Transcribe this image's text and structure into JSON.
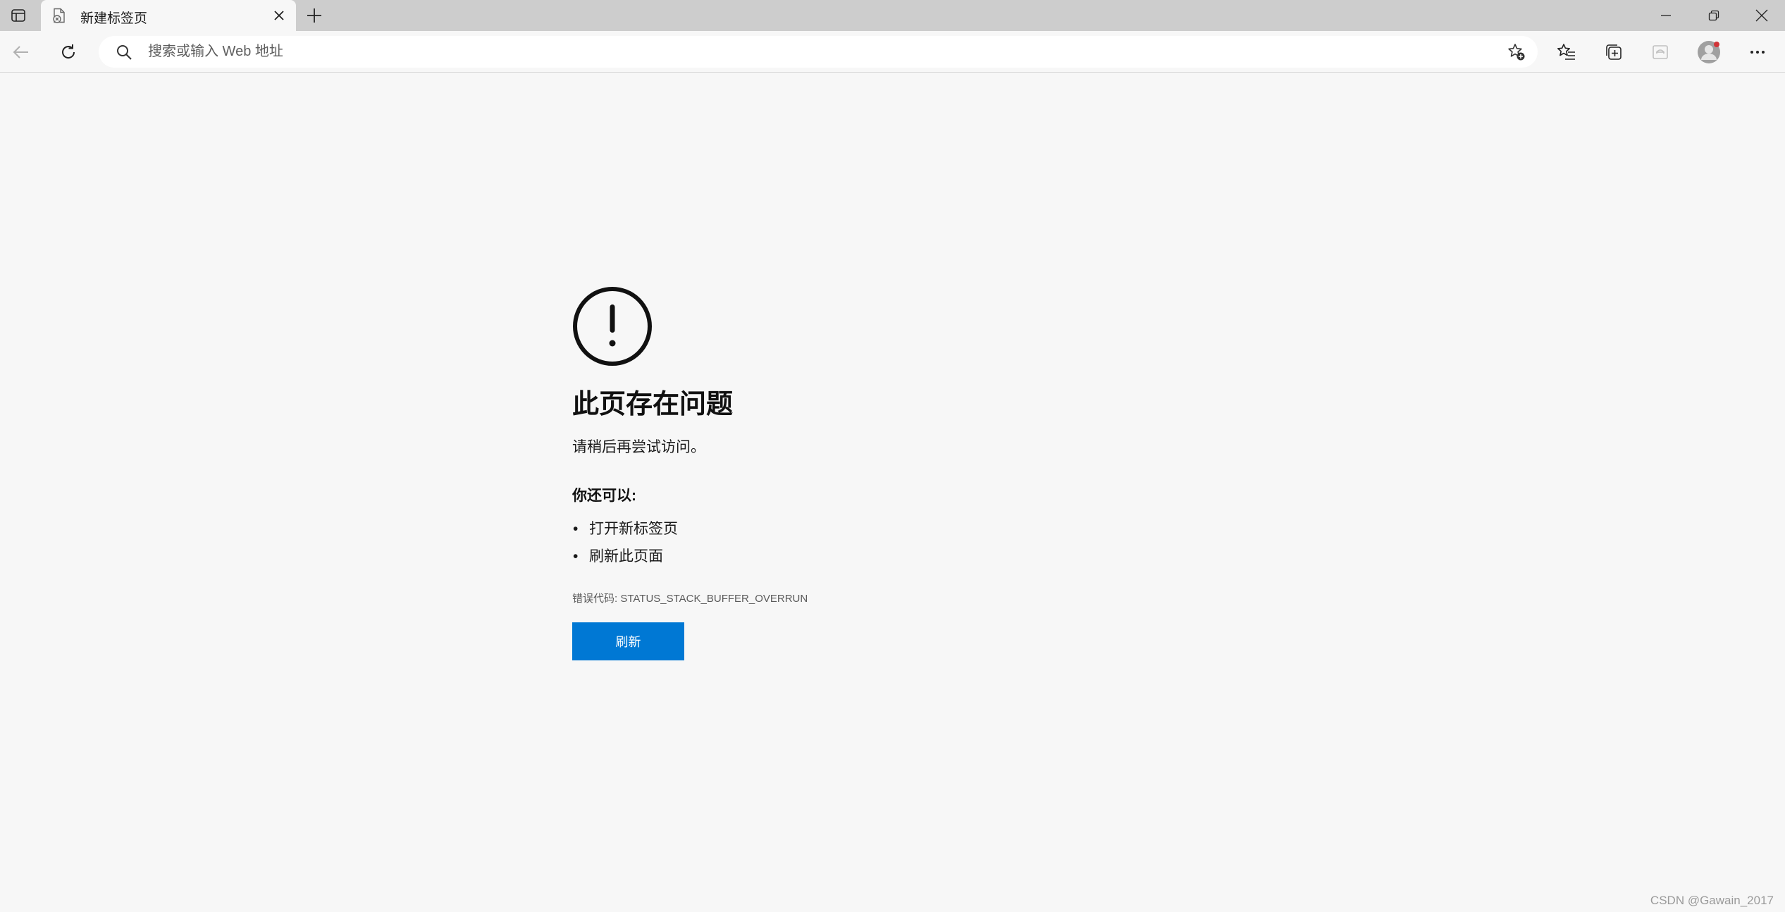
{
  "tab": {
    "title": "新建标签页"
  },
  "addressbar": {
    "placeholder": "搜索或输入 Web 地址",
    "value": ""
  },
  "error": {
    "title": "此页存在问题",
    "subtitle": "请稍后再尝试访问。",
    "also_heading": "你还可以:",
    "suggestions": [
      {
        "text": "打开新标签页"
      },
      {
        "text": "刷新此页面"
      }
    ],
    "code_text": "错误代码: STATUS_STACK_BUFFER_OVERRUN",
    "refresh_label": "刷新"
  },
  "watermark": "CSDN @Gawain_2017",
  "colors": {
    "accent": "#0078d4",
    "tabstrip": "#cdcdcd",
    "page_bg": "#f7f7f7",
    "badge": "#d13438"
  },
  "icons": [
    "tab-actions-icon",
    "tab-error-favicon",
    "close-icon",
    "plus-icon",
    "minimize-icon",
    "restore-icon",
    "window-close-icon",
    "back-arrow-icon",
    "refresh-icon",
    "search-icon",
    "add-favorite-icon",
    "favorites-icon",
    "collections-icon",
    "ie-mode-icon",
    "profile-icon",
    "more-icon",
    "exclamation-circle-icon"
  ]
}
